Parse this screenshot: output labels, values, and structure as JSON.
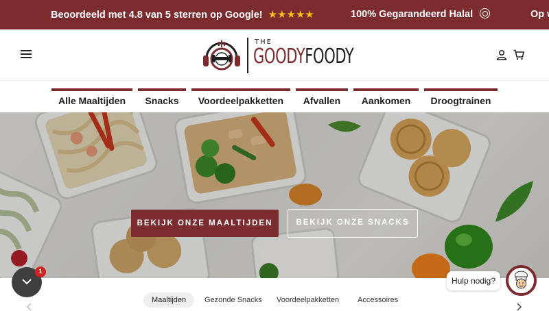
{
  "announcement": {
    "rating_text": "Beoordeeld met 4.8 van 5 sterren op Google!",
    "stars": "★★★★★",
    "halal_text": "100% Gegarandeerd Halal",
    "partial_text": "Op w"
  },
  "header": {
    "logo_the": "THE",
    "logo_goody": "GOODY",
    "logo_foody": "FOODY"
  },
  "nav": {
    "items": [
      {
        "label": "Alle Maaltijden"
      },
      {
        "label": "Snacks"
      },
      {
        "label": "Voordeelpakketten"
      },
      {
        "label": "Afvallen"
      },
      {
        "label": "Aankomen"
      },
      {
        "label": "Droogtrainen"
      }
    ]
  },
  "hero": {
    "meals_button": "BEKIJK ONZE MAALTIJDEN",
    "snacks_button": "BEKIJK ONZE SNACKS"
  },
  "chat": {
    "badge_count": "1",
    "help_text": "Hulp nodig?"
  },
  "tabs": {
    "items": [
      {
        "label": "Maaltijden",
        "active": true
      },
      {
        "label": "Gezonde Snacks",
        "active": false
      },
      {
        "label": "Voordeelpakketten",
        "active": false
      },
      {
        "label": "Accessoires",
        "active": false
      }
    ]
  },
  "colors": {
    "brand": "#7c2b2e",
    "stars": "#f7c21b",
    "badge": "#d2221f"
  }
}
